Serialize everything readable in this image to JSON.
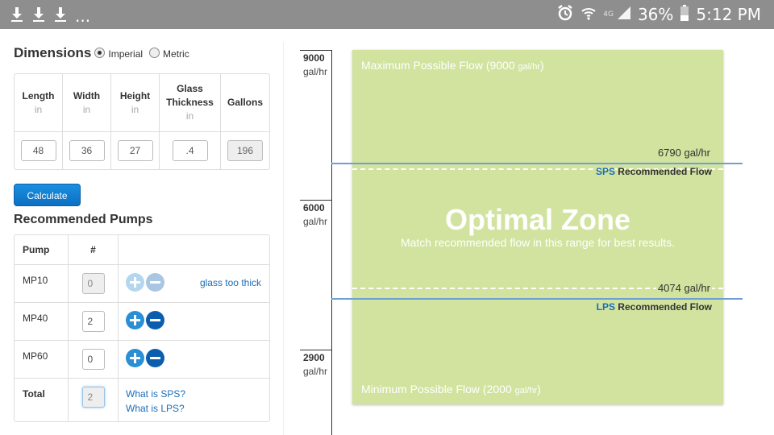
{
  "status_bar": {
    "overflow_dots": "...",
    "network_label": "4G",
    "battery_pct": "36%",
    "time": "5:12 PM",
    "icons": [
      "download-icon",
      "download-icon",
      "download-icon",
      "alarm-icon",
      "wifi-icon",
      "signal-icon",
      "battery-icon"
    ]
  },
  "dimensions": {
    "title": "Dimensions",
    "unit_options": [
      {
        "label": "Imperial",
        "selected": true
      },
      {
        "label": "Metric",
        "selected": false
      }
    ],
    "columns": [
      {
        "label": "Length",
        "unit": "in",
        "value": "48"
      },
      {
        "label": "Width",
        "unit": "in",
        "value": "36"
      },
      {
        "label": "Height",
        "unit": "in",
        "value": "27"
      },
      {
        "label": "Glass Thickness",
        "unit": "in",
        "value": ".4"
      },
      {
        "label": "Gallons",
        "unit": "",
        "value": "196"
      }
    ],
    "calculate_label": "Calculate"
  },
  "pumps": {
    "title": "Recommended Pumps",
    "headers": [
      "Pump",
      "#",
      ""
    ],
    "rows": [
      {
        "name": "MP10",
        "qty": "0",
        "note": "glass too thick"
      },
      {
        "name": "MP40",
        "qty": "2",
        "note": ""
      },
      {
        "name": "MP60",
        "qty": "0",
        "note": ""
      }
    ],
    "total": {
      "label": "Total",
      "qty": "2"
    },
    "links": [
      "What is SPS?",
      "What is LPS?"
    ]
  },
  "chart_data": {
    "type": "range",
    "y_unit": "gal/hr",
    "ticks": [
      {
        "value": "9000",
        "unit": "gal/hr"
      },
      {
        "value": "6000",
        "unit": "gal/hr"
      },
      {
        "value": "2900",
        "unit": "gal/hr"
      }
    ],
    "max_flow": {
      "text": "Maximum Possible Flow (9000 ",
      "unit": "gal/hr",
      "close": ")",
      "value": 9000
    },
    "min_flow": {
      "text": "Minimum Possible Flow (2000 ",
      "unit": "gal/hr",
      "close": ")",
      "value": 2000
    },
    "optimal_title": "Optimal Zone",
    "optimal_subtitle": "Match recommended flow in this range for best results.",
    "upper": {
      "value": 6790,
      "label": "6790 gal/hr",
      "acronym": "SPS",
      "rec_label": " Recommended Flow"
    },
    "lower": {
      "value": 4074,
      "label": "4074 gal/hr",
      "acronym": "LPS",
      "rec_label": " Recommended Flow"
    },
    "colors": {
      "zone": "#d1e39f",
      "line": "#6f9fd3",
      "accent": "#1a6eb8"
    }
  }
}
